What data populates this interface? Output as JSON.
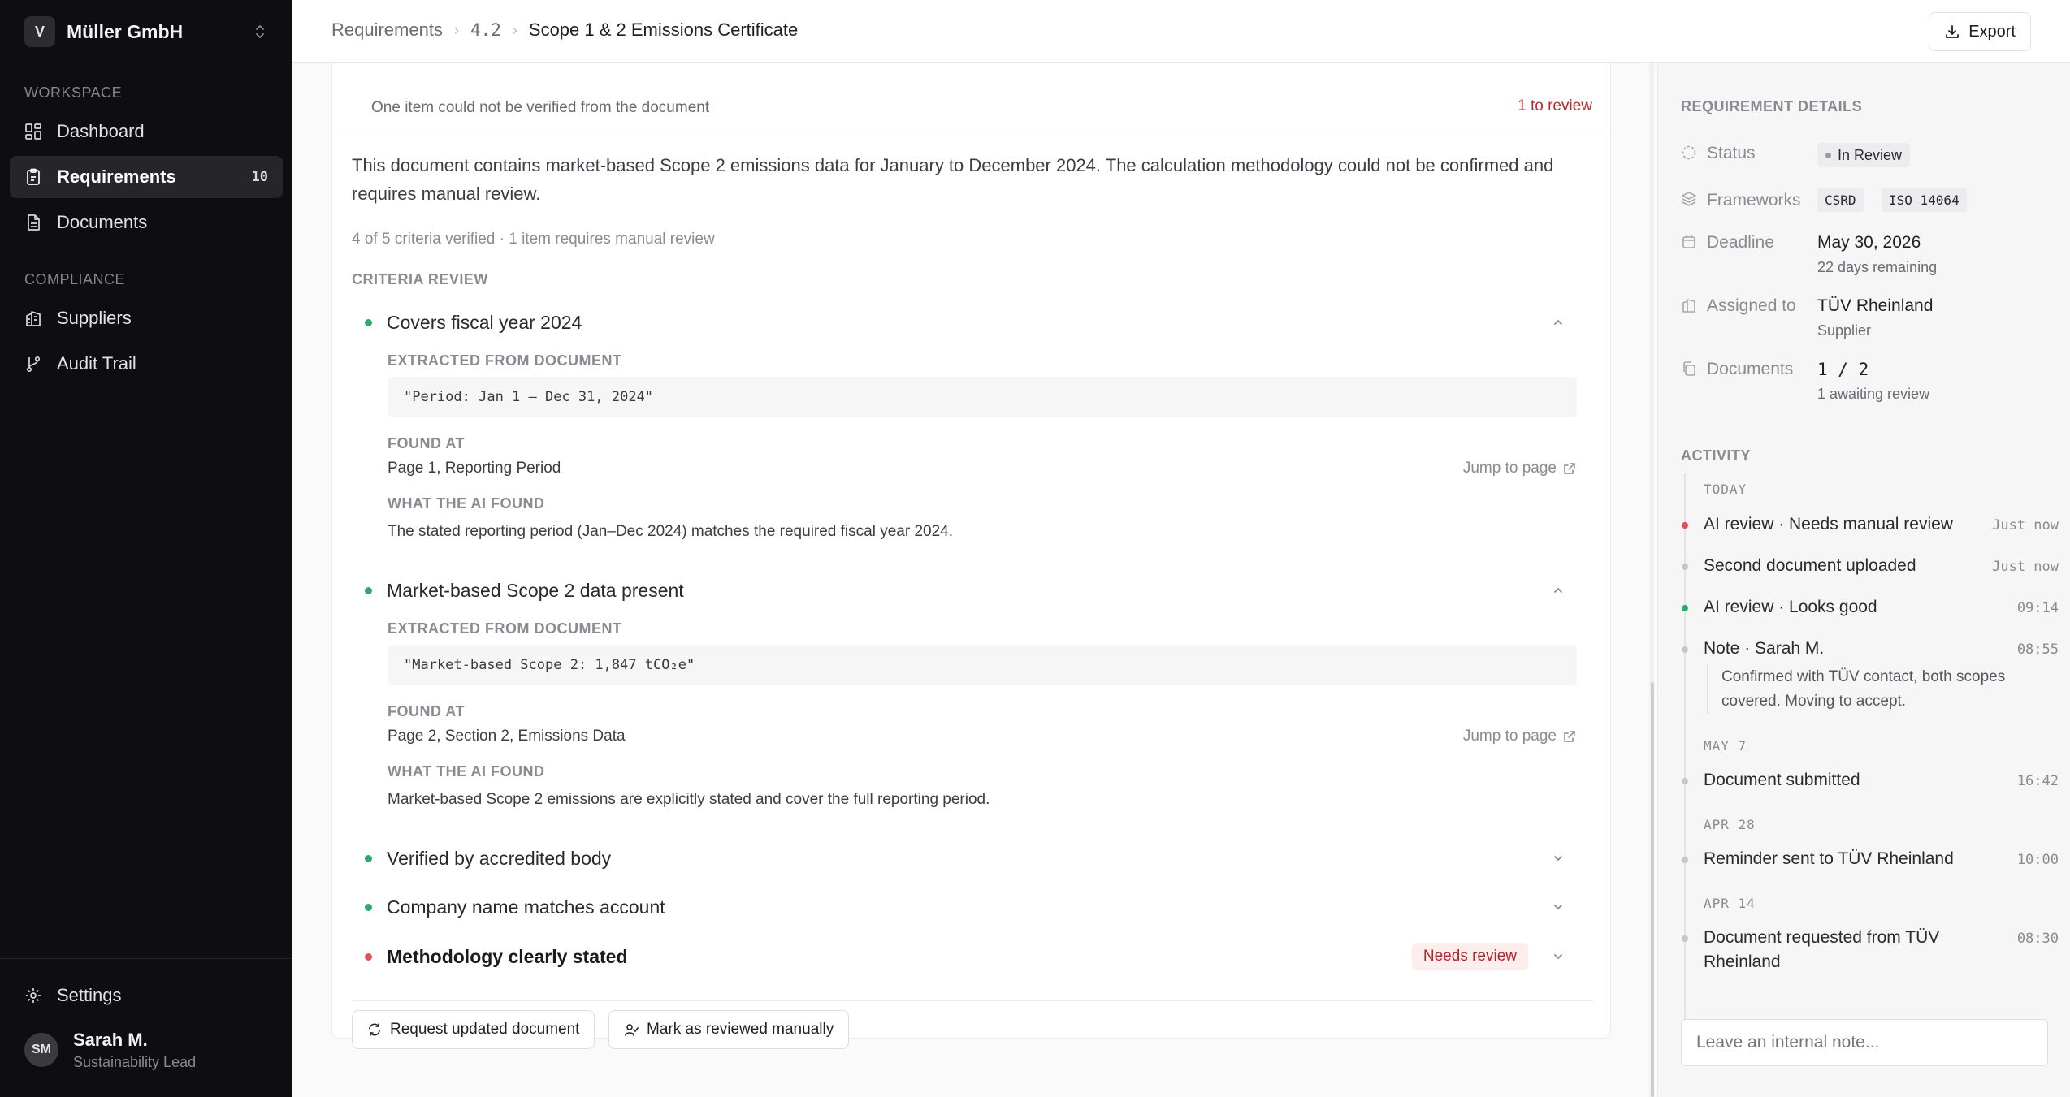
{
  "sidebar": {
    "org_initial": "V",
    "org_name": "Müller GmbH",
    "workspace_label": "WORKSPACE",
    "compliance_label": "COMPLIANCE",
    "items": [
      {
        "label": "Dashboard",
        "icon": "grid-icon"
      },
      {
        "label": "Requirements",
        "icon": "clipboard-icon",
        "count": "10",
        "active": true
      },
      {
        "label": "Documents",
        "icon": "file-icon"
      },
      {
        "label": "Suppliers",
        "icon": "building-icon"
      },
      {
        "label": "Audit Trail",
        "icon": "git-branch-icon"
      }
    ],
    "settings_label": "Settings",
    "user": {
      "initials": "SM",
      "name": "Sarah M.",
      "role": "Sustainability Lead"
    }
  },
  "topbar": {
    "breadcrumb": [
      "Requirements",
      "4.2",
      "Scope 1 & 2 Emissions Certificate"
    ],
    "export_label": "Export"
  },
  "review": {
    "hint": "One item could not be verified from the document",
    "to_review": "1 to review",
    "summary": "This document contains market-based Scope 2 emissions data for January to December 2024. The calculation methodology could not be confirmed and requires manual review.",
    "criteria_count": "4 of 5 criteria verified · 1 item requires manual review",
    "criteria_title": "CRITERIA REVIEW",
    "extracted_label": "EXTRACTED FROM DOCUMENT",
    "found_label": "FOUND AT",
    "ai_label": "WHAT THE AI FOUND",
    "jump_label": "Jump to page",
    "criteria": [
      {
        "name": "Covers fiscal year 2024",
        "status": "verified",
        "quote": "\"Period: Jan 1 – Dec 31, 2024\"",
        "found_at": "Page 1, Reporting Period",
        "ai_found": "The stated reporting period (Jan–Dec 2024) matches the required fiscal year 2024."
      },
      {
        "name": "Market-based Scope 2 data present",
        "status": "verified",
        "quote": "\"Market-based Scope 2: 1,847 tCO₂e\"",
        "found_at": "Page 2, Section 2, Emissions Data",
        "ai_found": "Market-based Scope 2 emissions are explicitly stated and cover the full reporting period."
      },
      {
        "name": "Verified by accredited body",
        "status": "verified"
      },
      {
        "name": "Company name matches account",
        "status": "verified"
      },
      {
        "name": "Methodology clearly stated",
        "status": "needs-review",
        "badge": "Needs review"
      }
    ],
    "request_button": "Request updated document",
    "manual_button": "Mark as reviewed manually"
  },
  "details": {
    "title": "REQUIREMENT DETAILS",
    "status_key": "Status",
    "status_value": "In Review",
    "frameworks_key": "Frameworks",
    "frameworks": [
      "CSRD",
      "ISO 14064"
    ],
    "deadline_key": "Deadline",
    "deadline_value": "May 30, 2026",
    "deadline_sub": "22 days remaining",
    "assigned_key": "Assigned to",
    "assigned_value": "TÜV Rheinland",
    "assigned_sub": "Supplier",
    "documents_key": "Documents",
    "documents_value": "1 / 2",
    "documents_sub": "1 awaiting review"
  },
  "activity": {
    "title": "ACTIVITY",
    "days": [
      "TODAY",
      "MAY 7",
      "APR 28",
      "APR 14"
    ],
    "events": [
      {
        "text": "AI review · Needs manual review",
        "time": "Just now",
        "color": "#e0525b"
      },
      {
        "text": "Second document uploaded",
        "time": "Just now"
      },
      {
        "text": "AI review · Looks good",
        "time": "09:14",
        "color": "#2daa6b"
      },
      {
        "text": "Note · Sarah M.",
        "time": "08:55",
        "note": "Confirmed with TÜV contact, both scopes covered. Moving to accept."
      },
      {
        "text": "Document submitted",
        "time": "16:42"
      },
      {
        "text": "Reminder sent to TÜV Rheinland",
        "time": "10:00"
      },
      {
        "text": "Document requested from TÜV Rheinland",
        "time": "08:30"
      }
    ],
    "note_placeholder": "Leave an internal note..."
  }
}
